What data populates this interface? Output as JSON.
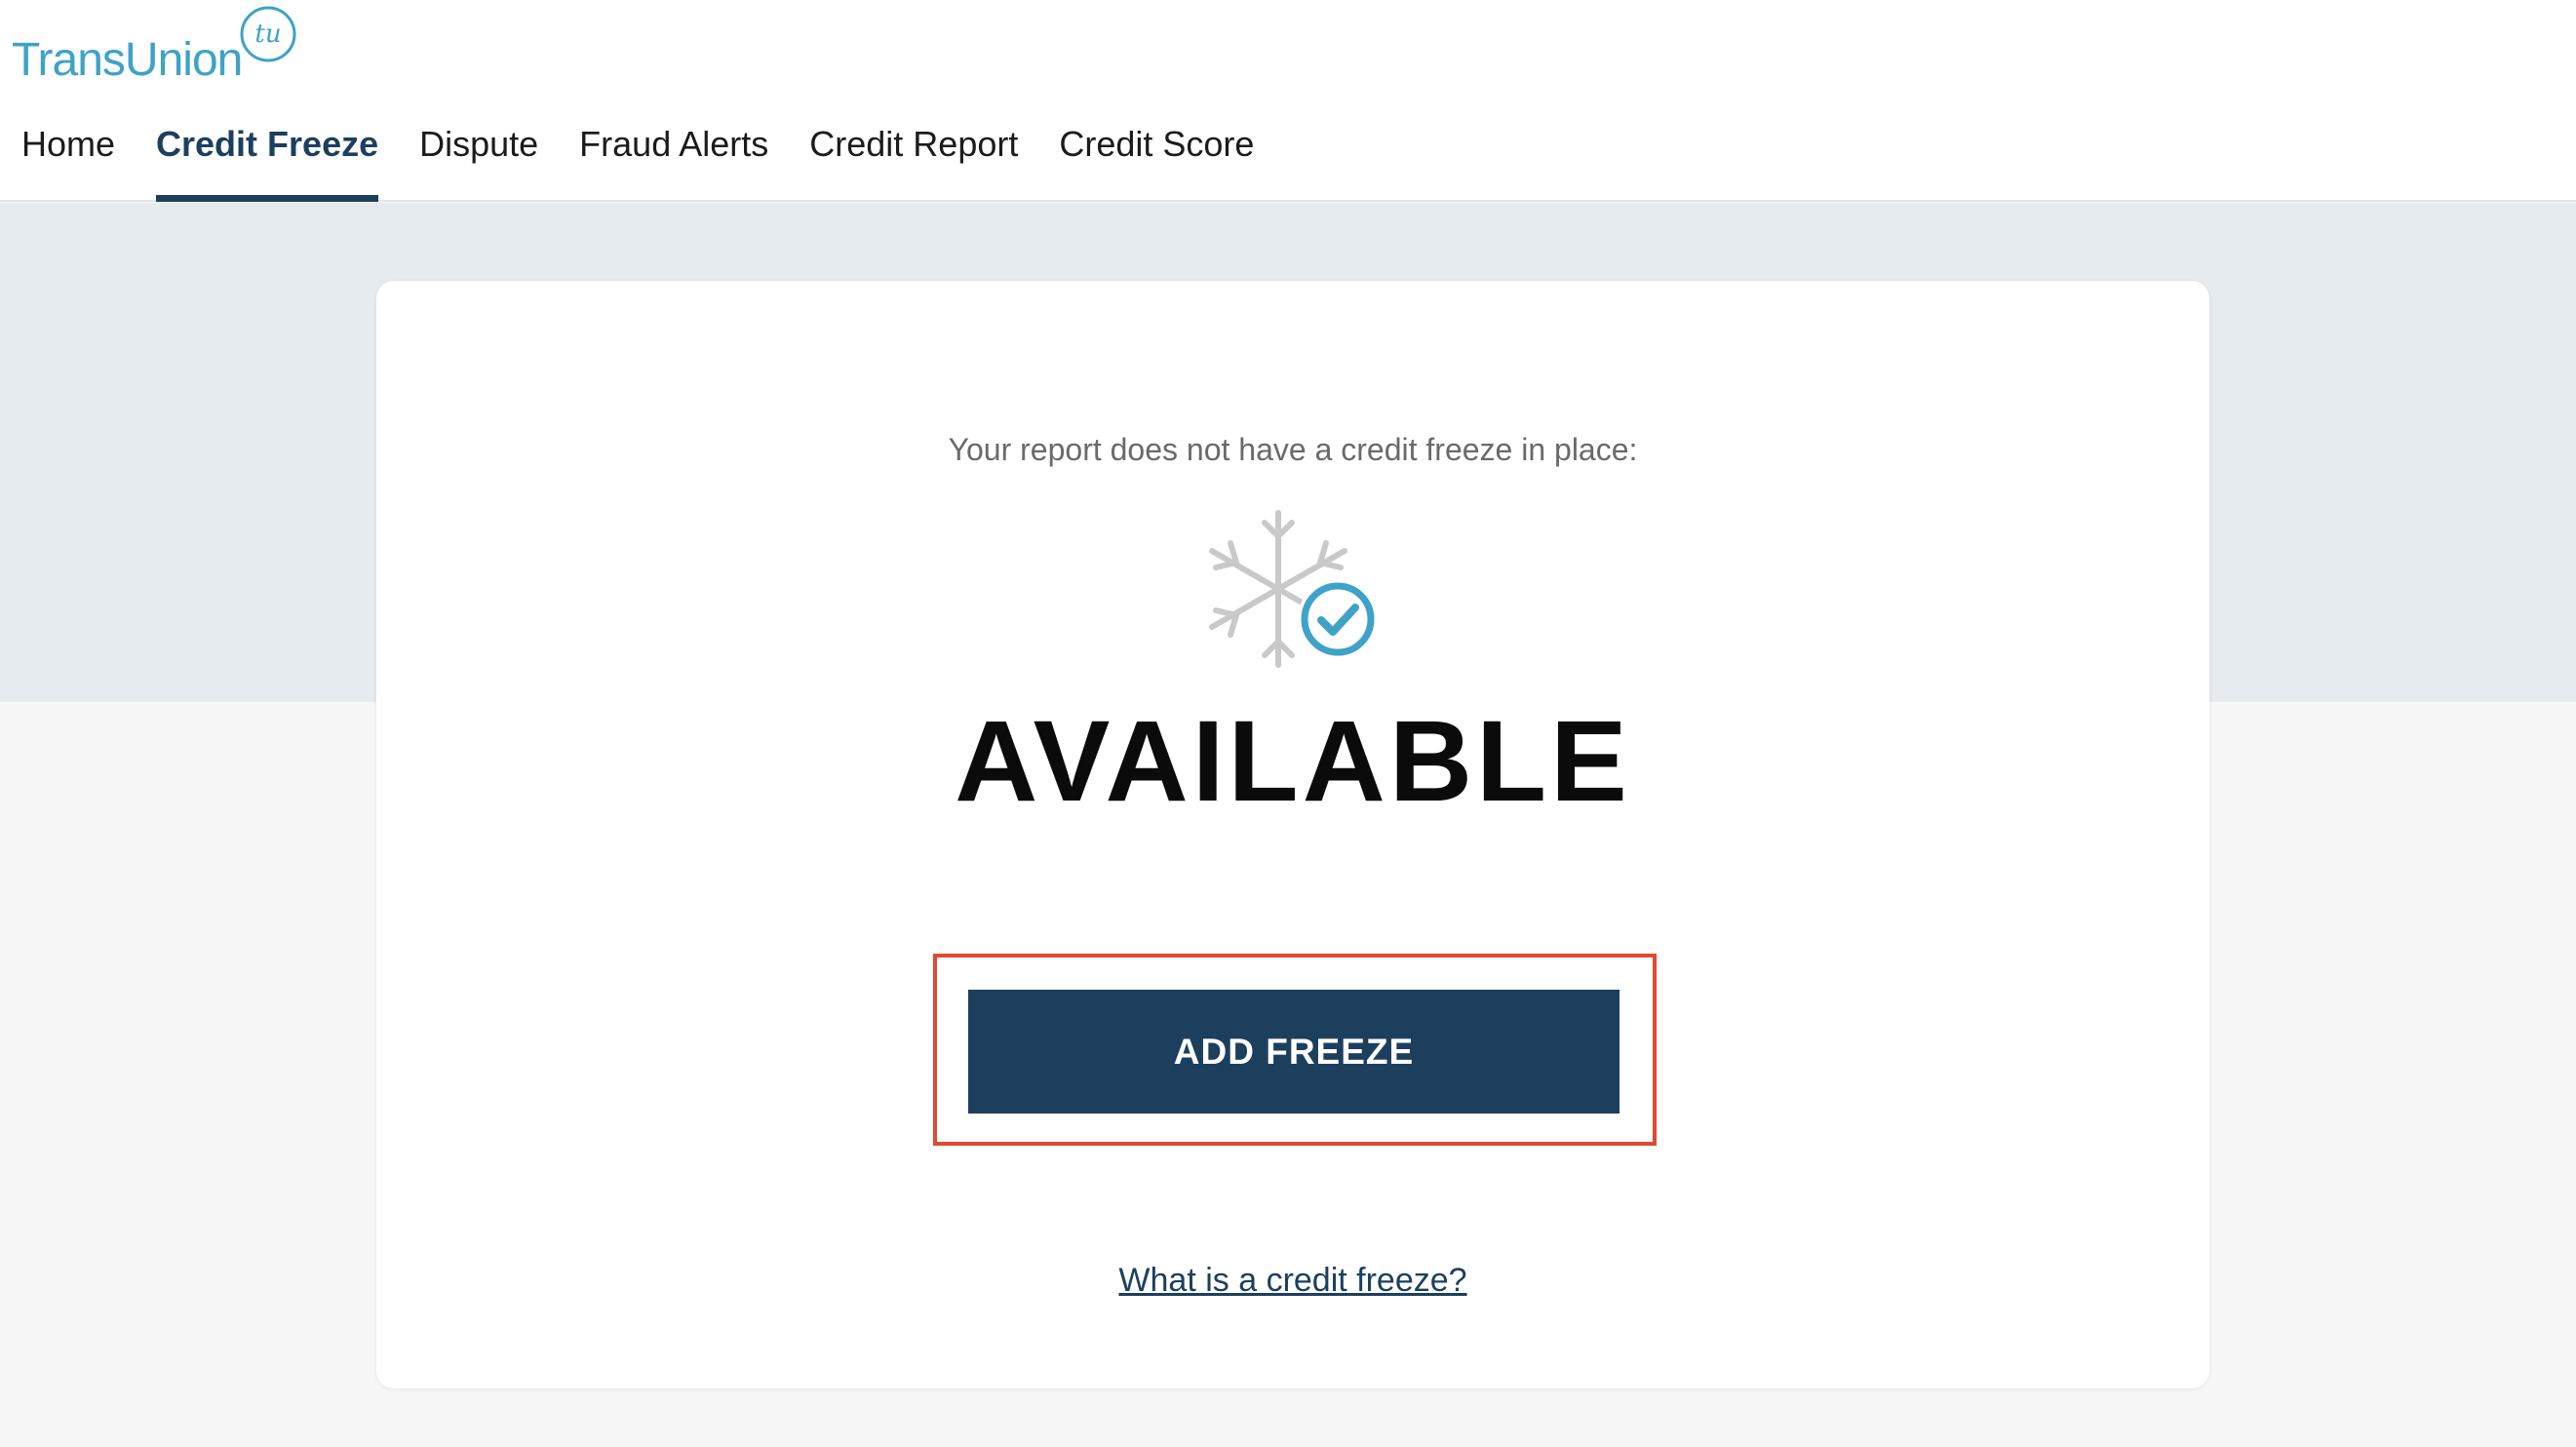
{
  "brand": {
    "name": "TransUnion",
    "mark": "tu",
    "color": "#3fa2c8"
  },
  "nav": {
    "items": [
      {
        "label": "Home"
      },
      {
        "label": "Credit Freeze"
      },
      {
        "label": "Dispute"
      },
      {
        "label": "Fraud Alerts"
      },
      {
        "label": "Credit Report"
      },
      {
        "label": "Credit Score"
      }
    ],
    "active": "Credit Freeze"
  },
  "card": {
    "intro": "Your report does not have a credit freeze in place:",
    "icon": "snowflake-check-icon",
    "status": "AVAILABLE",
    "button_label": "ADD FREEZE",
    "link_text": "What is a credit freeze?"
  },
  "colors": {
    "primary": "#1c3f5e",
    "accent": "#3fa2c8",
    "highlight_border": "#e04a32"
  }
}
